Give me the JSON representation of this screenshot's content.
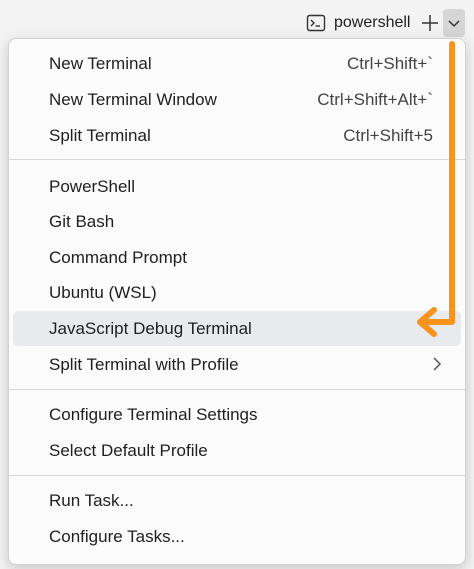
{
  "toolbar": {
    "terminal_name": "powershell",
    "terminal_icon": "terminal-icon",
    "new_terminal_icon": "plus-icon",
    "dropdown_icon": "chevron-down-icon"
  },
  "menu": {
    "groups": [
      [
        {
          "label": "New Terminal",
          "shortcut": "Ctrl+Shift+`"
        },
        {
          "label": "New Terminal Window",
          "shortcut": "Ctrl+Shift+Alt+`"
        },
        {
          "label": "Split Terminal",
          "shortcut": "Ctrl+Shift+5"
        }
      ],
      [
        {
          "label": "PowerShell"
        },
        {
          "label": "Git Bash"
        },
        {
          "label": "Command Prompt"
        },
        {
          "label": "Ubuntu (WSL)"
        },
        {
          "label": "JavaScript Debug Terminal",
          "highlighted": true
        },
        {
          "label": "Split Terminal with Profile",
          "submenu": true
        }
      ],
      [
        {
          "label": "Configure Terminal Settings"
        },
        {
          "label": "Select Default Profile"
        }
      ],
      [
        {
          "label": "Run Task..."
        },
        {
          "label": "Configure Tasks..."
        }
      ]
    ]
  },
  "colors": {
    "annotation_orange": "#f7931e",
    "highlight_bg": "#e8eaed",
    "menu_bg": "#fbfbfb",
    "dropdown_btn_bg": "#d6d6d6"
  }
}
